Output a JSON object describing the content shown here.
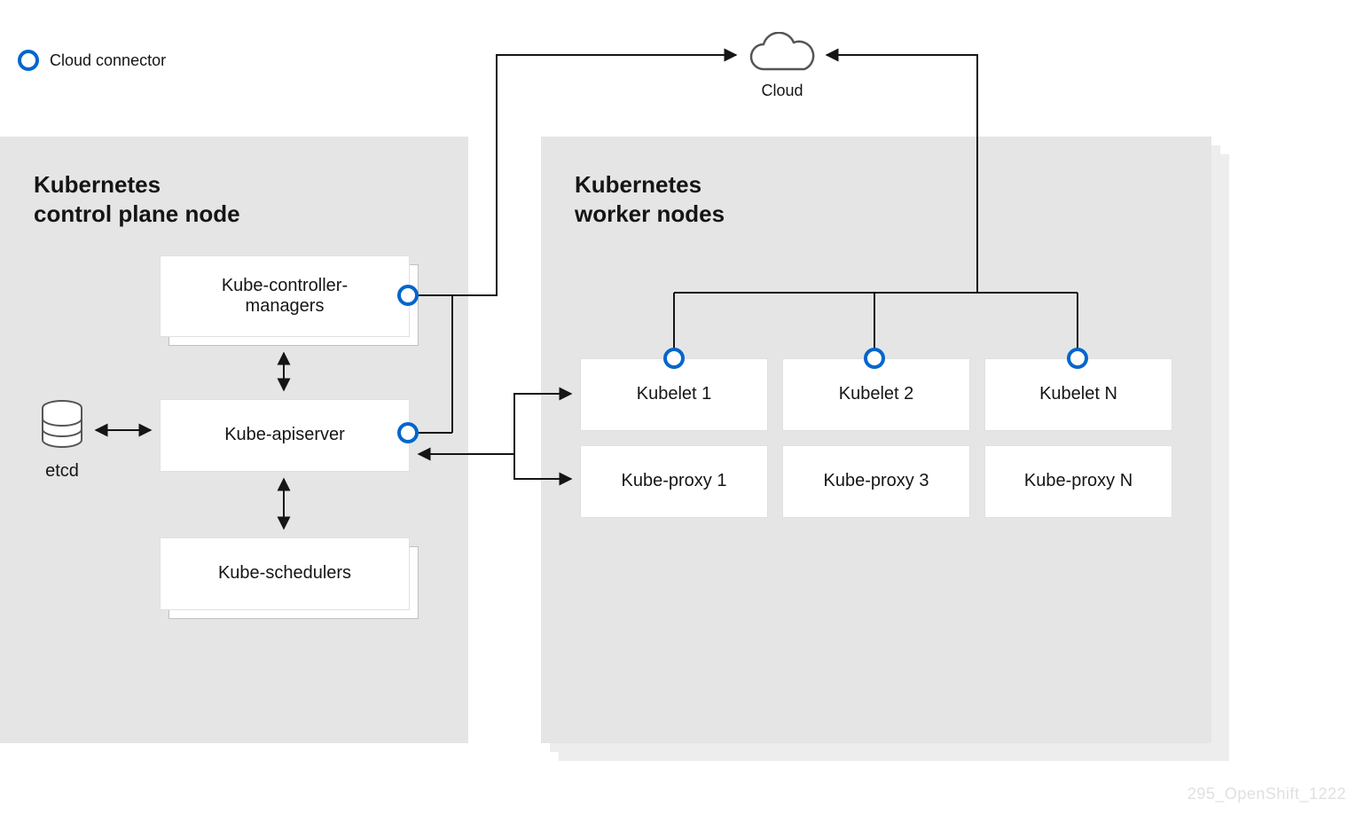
{
  "legend": {
    "label": "Cloud connector"
  },
  "cloud": {
    "label": "Cloud"
  },
  "control_plane": {
    "title": "Kubernetes\ncontrol plane node",
    "etcd_label": "etcd",
    "controller_managers": "Kube-controller-\nmanagers",
    "apiserver": "Kube-apiserver",
    "schedulers": "Kube-schedulers"
  },
  "worker": {
    "title": "Kubernetes\nworker nodes",
    "kubelets": [
      "Kubelet 1",
      "Kubelet 2",
      "Kubelet N"
    ],
    "proxies": [
      "Kube-proxy 1",
      "Kube-proxy 3",
      "Kube-proxy N"
    ]
  },
  "footer": {
    "id": "295_OpenShift_1222"
  }
}
